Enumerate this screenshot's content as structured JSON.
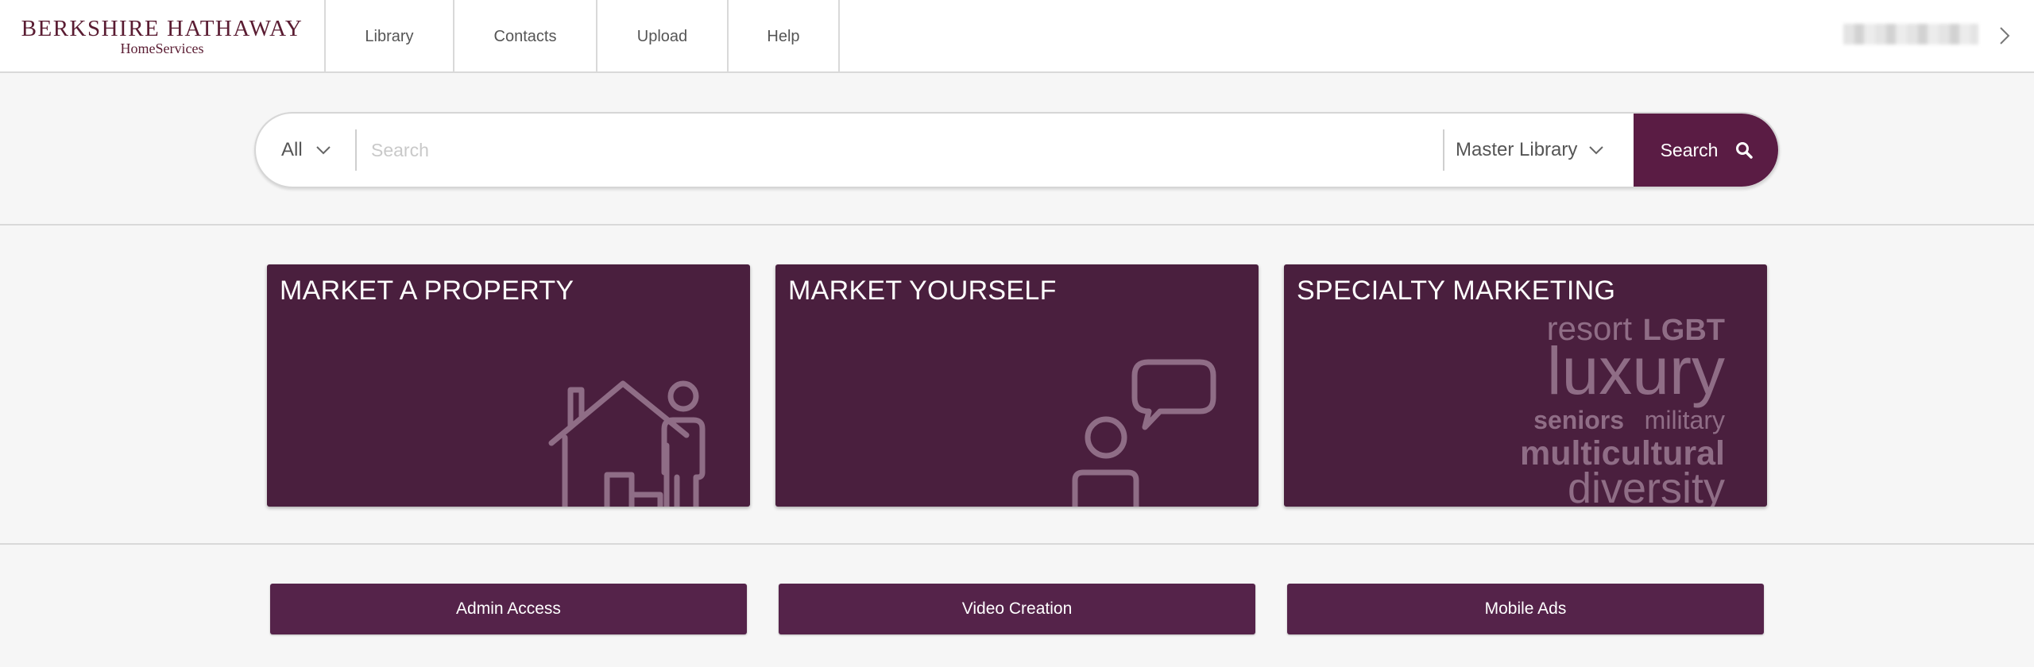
{
  "brand": {
    "name": "BERKSHIRE HATHAWAY",
    "sub": "HomeServices",
    "color": "#5a1c32"
  },
  "nav": {
    "items": [
      {
        "label": "Library"
      },
      {
        "label": "Contacts"
      },
      {
        "label": "Upload"
      },
      {
        "label": "Help"
      }
    ]
  },
  "user": {
    "chevron_icon": "chevron-right-icon"
  },
  "search": {
    "scope_value": "All",
    "placeholder": "Search",
    "value": "",
    "library_value": "Master Library",
    "button_label": "Search",
    "button_icon": "search-icon",
    "accent": "#5a1c44"
  },
  "cards": [
    {
      "title": "MARKET A PROPERTY",
      "icon": "house-person-icon"
    },
    {
      "title": "MARKET YOURSELF",
      "icon": "person-speech-icon"
    },
    {
      "title": "SPECIALTY MARKETING",
      "icon": "word-cloud",
      "words": [
        "resort",
        "LGBT",
        "luxury",
        "seniors",
        "military",
        "multicultural",
        "diversity"
      ]
    }
  ],
  "card_color": "#4a1f3e",
  "actions": [
    {
      "label": "Admin Access"
    },
    {
      "label": "Video Creation"
    },
    {
      "label": "Mobile Ads"
    }
  ]
}
